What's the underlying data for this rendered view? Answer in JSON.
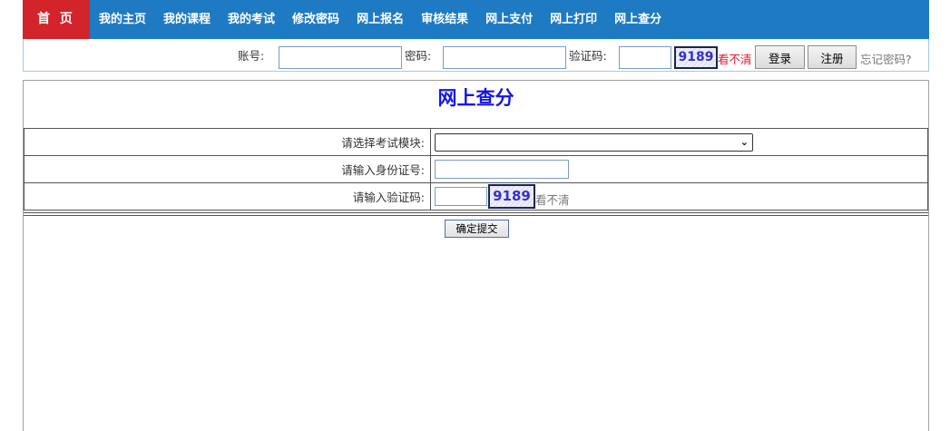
{
  "nav": {
    "home": "首 页",
    "items": [
      "我的主页",
      "我的课程",
      "我的考试",
      "修改密码",
      "网上报名",
      "审核结果",
      "网上支付",
      "网上打印",
      "网上查分"
    ]
  },
  "login": {
    "account_label": "账号:",
    "password_label": "密码:",
    "captcha_label": "验证码:",
    "captcha_code": "9189",
    "unclear": "看不清",
    "login_button": "登录",
    "register_button": "注册",
    "forgot": "忘记密码?"
  },
  "page": {
    "title": "网上查分"
  },
  "form": {
    "module_label": "请选择考试模块:",
    "module_selected": "",
    "id_label": "请输入身份证号:",
    "id_value": "",
    "captcha_label": "请输入验证码:",
    "captcha_value": "",
    "captcha_code": "9189",
    "unclear": "看不清",
    "submit": "确定提交"
  },
  "colors": {
    "nav_bg": "#1d7ac3",
    "home_bg": "#d3242b",
    "title": "#1515e6",
    "captcha_text": "#3530c8",
    "unclear_red": "#e0192d"
  }
}
